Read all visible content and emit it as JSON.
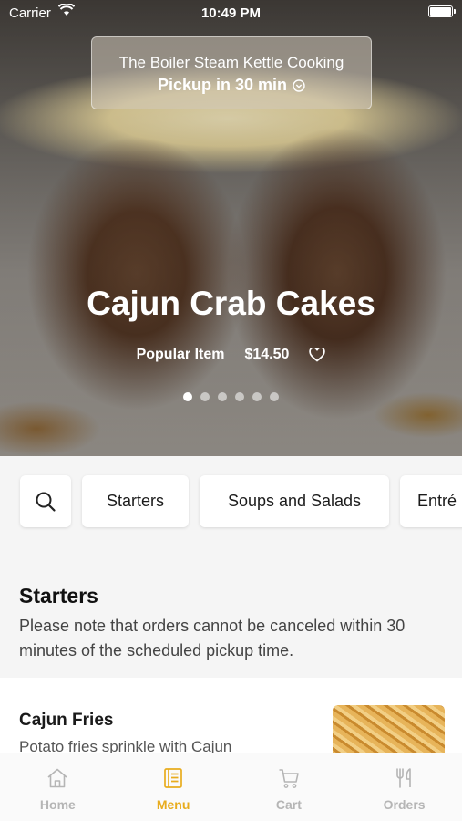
{
  "status_bar": {
    "carrier": "Carrier",
    "time": "10:49 PM"
  },
  "hero": {
    "restaurant": "The Boiler Steam Kettle Cooking",
    "pickup": "Pickup in 30 min",
    "dish_title": "Cajun Crab Cakes",
    "badge": "Popular Item",
    "price": "$14.50",
    "carousel": {
      "count": 6,
      "active_index": 0
    }
  },
  "categories": [
    "Starters",
    "Soups and Salads",
    "Entré"
  ],
  "section": {
    "title": "Starters",
    "note": "Please note that orders cannot be canceled within 30 minutes of the scheduled pickup time."
  },
  "item": {
    "name": "Cajun Fries",
    "description": "Potato fries sprinkle with Cajun"
  },
  "tabs": [
    {
      "label": "Home",
      "icon": "home-icon"
    },
    {
      "label": "Menu",
      "icon": "menu-book-icon",
      "active": true
    },
    {
      "label": "Cart",
      "icon": "cart-icon"
    },
    {
      "label": "Orders",
      "icon": "fork-knife-icon"
    }
  ],
  "colors": {
    "accent": "#e8ac1e",
    "inactive": "#b5b5b5"
  }
}
